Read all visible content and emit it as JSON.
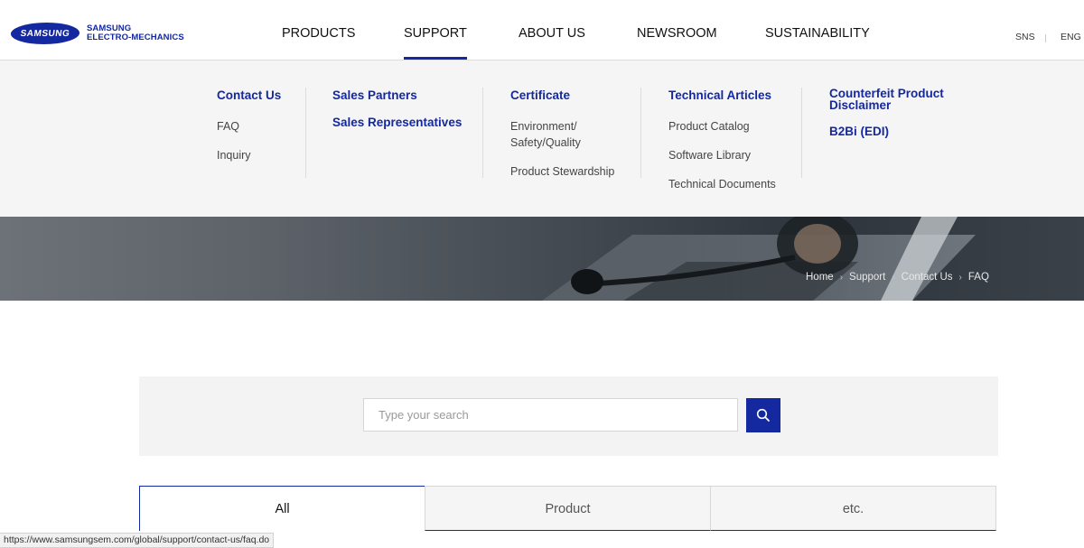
{
  "header": {
    "logo": {
      "brand": "SAMSUNG",
      "line1": "SAMSUNG",
      "line2": "ELECTRO-MECHANICS"
    },
    "nav": [
      {
        "label": "PRODUCTS",
        "active": false
      },
      {
        "label": "SUPPORT",
        "active": true
      },
      {
        "label": "ABOUT US",
        "active": false
      },
      {
        "label": "NEWSROOM",
        "active": false
      },
      {
        "label": "SUSTAINABILITY",
        "active": false
      }
    ],
    "util": {
      "sns": "SNS",
      "lang": "ENG"
    }
  },
  "mega": {
    "columns": [
      {
        "main": [
          "Contact Us"
        ],
        "sub": [
          "FAQ",
          "Inquiry"
        ]
      },
      {
        "main": [
          "Sales Partners",
          "Sales Representatives"
        ],
        "sub": []
      },
      {
        "main": [
          "Certificate"
        ],
        "sub": [
          "Environment/\nSafety/Quality",
          "Product Stewardship"
        ]
      },
      {
        "main": [
          "Technical Articles"
        ],
        "sub": [
          "Product Catalog",
          "Software Library",
          "Technical Documents"
        ]
      },
      {
        "main": [
          "Counterfeit Product Disclaimer",
          "B2Bi (EDI)"
        ],
        "sub": []
      }
    ]
  },
  "breadcrumb": [
    "Home",
    "Support",
    "Contact Us",
    "FAQ"
  ],
  "search": {
    "placeholder": "Type your search",
    "value": ""
  },
  "tabs": [
    {
      "label": "All",
      "active": true
    },
    {
      "label": "Product",
      "active": false
    },
    {
      "label": "etc.",
      "active": false
    }
  ],
  "status_url": "https://www.samsungsem.com/global/support/contact-us/faq.do",
  "colors": {
    "brand": "#1428a0",
    "mega_bg": "#f5f5f5",
    "search_bg": "#f3f3f3"
  }
}
